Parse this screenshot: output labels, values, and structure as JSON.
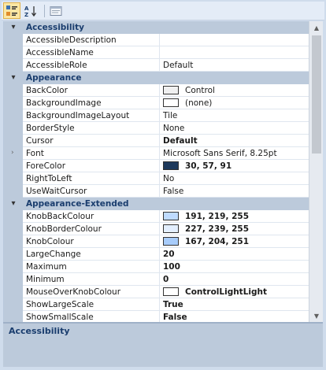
{
  "toolbar": {
    "buttons": [
      {
        "name": "categorized-button",
        "icon": "categorized-icon",
        "active": true
      },
      {
        "name": "alphabetical-button",
        "icon": "sort-az-icon",
        "active": false
      },
      {
        "name": "property-pages-button",
        "icon": "property-pages-icon",
        "active": false
      }
    ]
  },
  "rows": [
    {
      "type": "category",
      "label": "Accessibility",
      "toggle": "▾"
    },
    {
      "name": "AccessibleDescription",
      "value": ""
    },
    {
      "name": "AccessibleName",
      "value": ""
    },
    {
      "name": "AccessibleRole",
      "value": "Default"
    },
    {
      "type": "category",
      "label": "Appearance",
      "toggle": "▾"
    },
    {
      "name": "BackColor",
      "value": "Control",
      "swatch": "#f0f0f0"
    },
    {
      "name": "BackgroundImage",
      "value": "(none)",
      "swatch": "#ffffff"
    },
    {
      "name": "BackgroundImageLayout",
      "value": "Tile"
    },
    {
      "name": "BorderStyle",
      "value": "None"
    },
    {
      "name": "Cursor",
      "value": "Default",
      "bold": true
    },
    {
      "name": "Font",
      "value": "Microsoft Sans Serif, 8.25pt",
      "expandable": true
    },
    {
      "name": "ForeColor",
      "value": "30, 57, 91",
      "swatch": "#1e395b",
      "bold": true
    },
    {
      "name": "RightToLeft",
      "value": "No"
    },
    {
      "name": "UseWaitCursor",
      "value": "False"
    },
    {
      "type": "category",
      "label": "Appearance-Extended",
      "toggle": "▾"
    },
    {
      "name": "KnobBackColour",
      "value": "191, 219, 255",
      "swatch": "#bfdbff",
      "bold": true
    },
    {
      "name": "KnobBorderColour",
      "value": "227, 239, 255",
      "swatch": "#e3efff",
      "bold": true
    },
    {
      "name": "KnobColour",
      "value": "167, 204, 251",
      "swatch": "#a7ccfb",
      "bold": true
    },
    {
      "name": "LargeChange",
      "value": "20",
      "bold": true
    },
    {
      "name": "Maximum",
      "value": "100",
      "bold": true
    },
    {
      "name": "Minimum",
      "value": "0",
      "bold": true
    },
    {
      "name": "MouseOverKnobColour",
      "value": "ControlLightLight",
      "swatch": "#ffffff",
      "bold": true
    },
    {
      "name": "ShowLargeScale",
      "value": "True",
      "bold": true
    },
    {
      "name": "ShowSmallScale",
      "value": "False",
      "bold": true
    }
  ],
  "description": {
    "title": "Accessibility"
  },
  "colors": {
    "category_bg": "#bccadb",
    "category_text": "#1a3d6e",
    "active_button": "#fbe6a3"
  }
}
